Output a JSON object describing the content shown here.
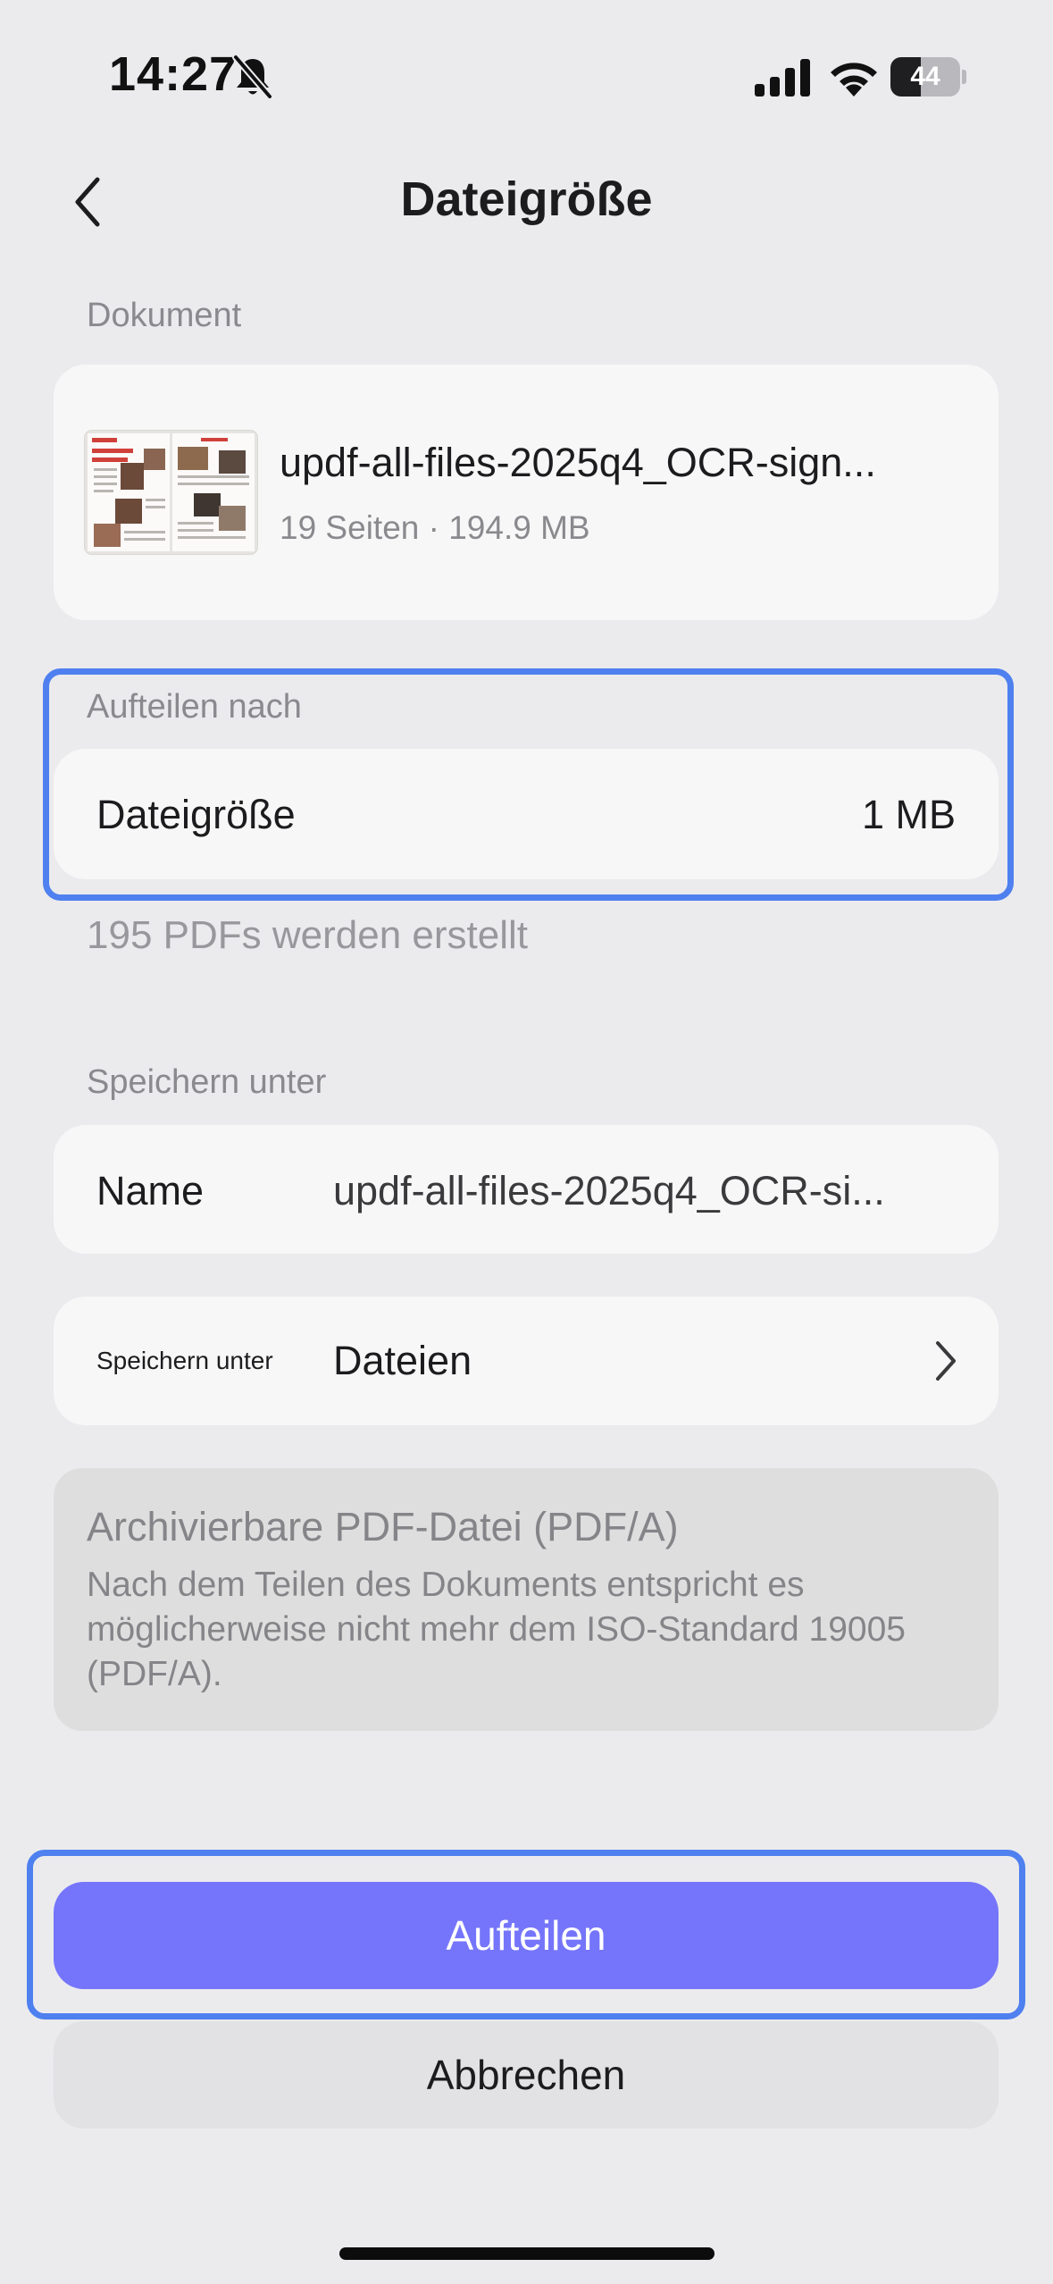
{
  "status_bar": {
    "time": "14:27",
    "battery_level": "44",
    "battery_fraction": 0.44,
    "icons": [
      "bell-slash-icon",
      "cellular-signal-icon",
      "wifi-icon",
      "battery-icon"
    ]
  },
  "nav": {
    "back_icon": "chevron-left-icon",
    "title": "Dateigröße"
  },
  "document": {
    "section_label": "Dokument",
    "file_name": "updf-all-files-2025q4_OCR-sign...",
    "meta": "19 Seiten · 194.9 MB"
  },
  "split": {
    "section_label": "Aufteilen nach",
    "row_label": "Dateigröße",
    "row_value": "1 MB",
    "info": "195 PDFs werden erstellt"
  },
  "save": {
    "section_label": "Speichern unter",
    "name_label": "Name",
    "name_value": "updf-all-files-2025q4_OCR-si...",
    "location_label": "Speichern unter",
    "location_value": "Dateien",
    "location_icon": "chevron-right-icon"
  },
  "pdfa": {
    "title": "Archivierbare PDF-Datei (PDF/A)",
    "description": "Nach dem Teilen des Dokuments entspricht es möglicherweise nicht mehr dem ISO-Standard 19005 (PDF/A)."
  },
  "actions": {
    "split_label": "Aufteilen",
    "cancel_label": "Abbrechen"
  },
  "colors": {
    "accent": "#7575fb",
    "highlight": "#4f80ef",
    "background": "#ebebee"
  }
}
